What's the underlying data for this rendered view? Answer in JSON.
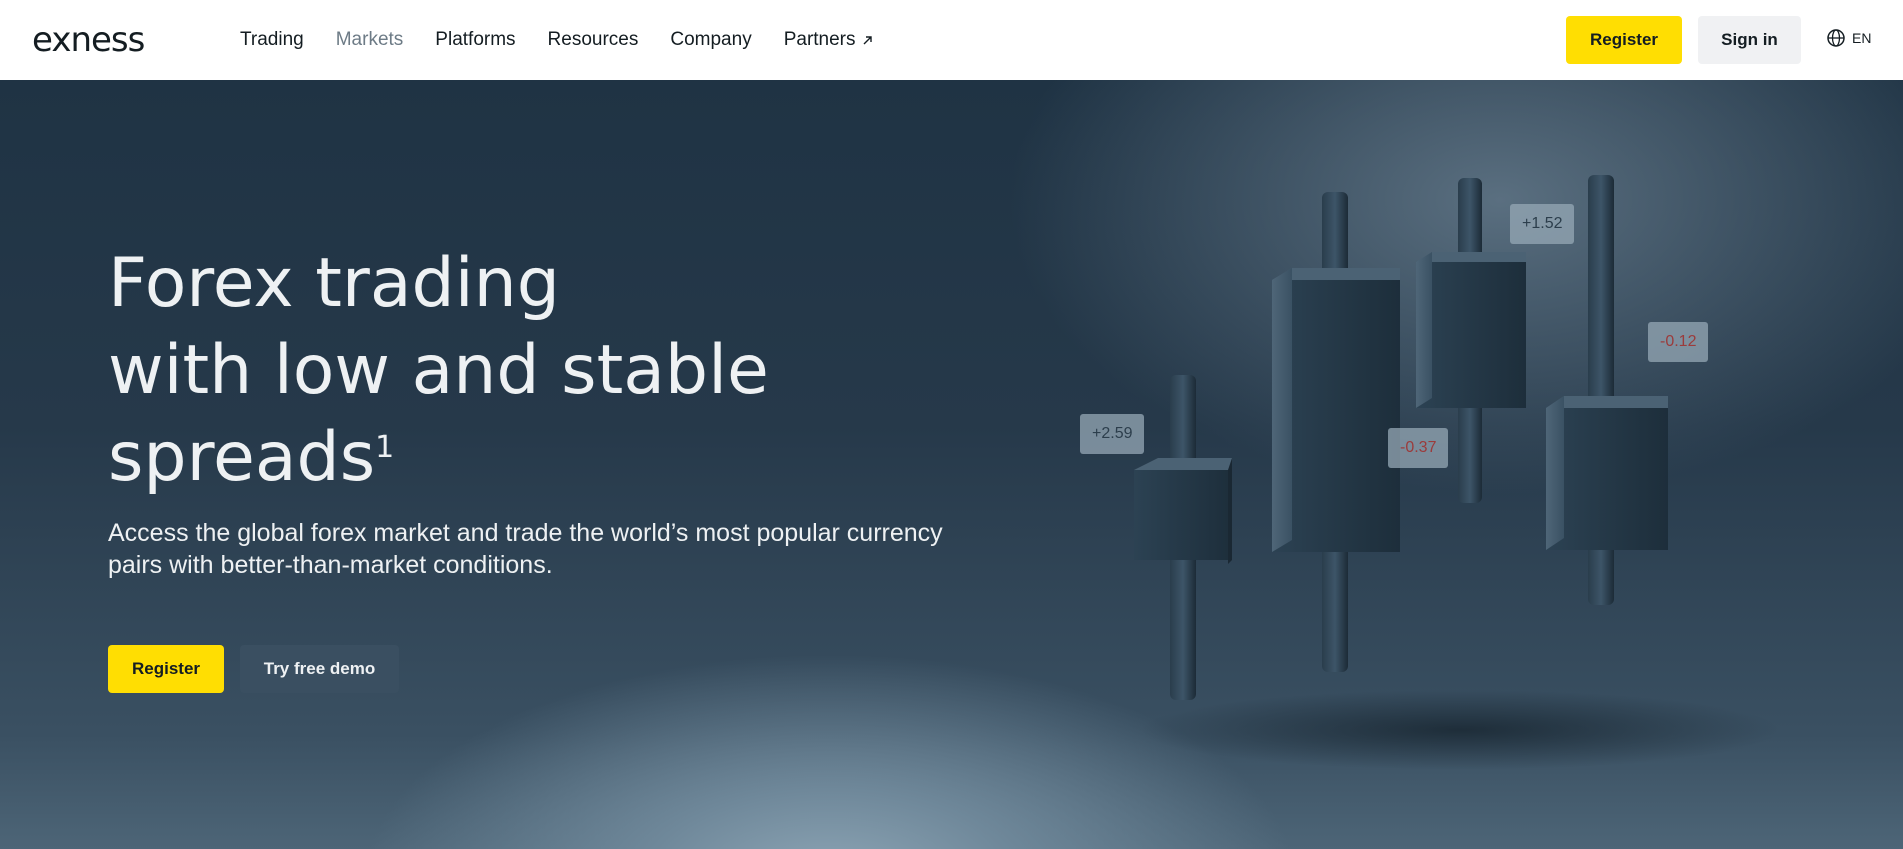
{
  "header": {
    "logo_text": "exness",
    "nav": [
      {
        "label": "Trading"
      },
      {
        "label": "Markets"
      },
      {
        "label": "Platforms"
      },
      {
        "label": "Resources"
      },
      {
        "label": "Company"
      },
      {
        "label": "Partners"
      }
    ],
    "register_label": "Register",
    "signin_label": "Sign in",
    "language": "EN"
  },
  "hero": {
    "title_line1": "Forex trading",
    "title_line2": "with low and stable",
    "title_line3": "spreads",
    "title_footnote": "1",
    "subtitle": "Access the global forex market and trade the world’s most popular currency pairs with better-than-market conditions.",
    "register_label": "Register",
    "demo_label": "Try free demo",
    "tags": [
      {
        "text": "+2.59",
        "kind": "positive"
      },
      {
        "text": "+1.52",
        "kind": "positive"
      },
      {
        "text": "-0.37",
        "kind": "negative"
      },
      {
        "text": "-0.12",
        "kind": "negative"
      }
    ]
  },
  "colors": {
    "accent_yellow": "#ffde02",
    "header_bg": "#ffffff",
    "hero_dark": "#243746",
    "text_light": "#eef1f3",
    "text_dark": "#141d22",
    "negative": "#9b3b3b"
  },
  "icons": {
    "external": "arrow-up-right-icon",
    "language": "globe-icon"
  }
}
